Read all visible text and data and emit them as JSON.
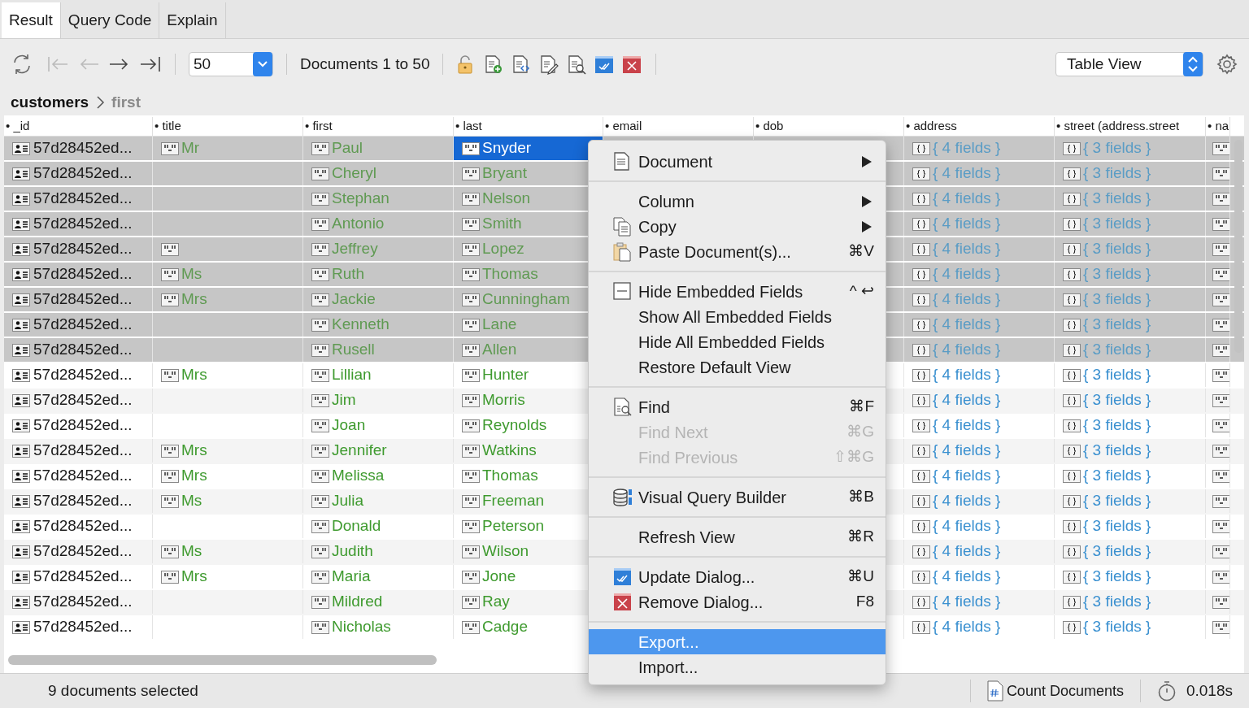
{
  "tabs": [
    {
      "label": "Result",
      "selected": true
    },
    {
      "label": "Query Code",
      "selected": false
    },
    {
      "label": "Explain",
      "selected": false
    }
  ],
  "toolbar": {
    "nav_buttons": [
      {
        "kind": "first",
        "disabled": true
      },
      {
        "kind": "previous",
        "disabled": true
      },
      {
        "kind": "next",
        "disabled": false
      },
      {
        "kind": "last",
        "disabled": false
      }
    ],
    "page_size": {
      "value": "50"
    },
    "range": "Documents 1 to 50",
    "actions": [
      {
        "kind": "lock"
      },
      {
        "kind": "add"
      },
      {
        "kind": "code"
      },
      {
        "kind": "edit"
      },
      {
        "kind": "find"
      },
      {
        "kind": "update"
      },
      {
        "kind": "remove"
      }
    ],
    "view": {
      "value": "Table View"
    }
  },
  "breadcrumb": [
    {
      "label": "customers",
      "current": false
    },
    {
      "label": "first",
      "current": true
    }
  ],
  "table": {
    "columns": [
      {
        "label": "• _id",
        "kind": "id"
      },
      {
        "label": "• title",
        "kind": "string"
      },
      {
        "label": "• first",
        "kind": "string"
      },
      {
        "label": "• last",
        "kind": "string"
      },
      {
        "label": "• email",
        "kind": "hidden"
      },
      {
        "label": "• dob",
        "kind": "hidden"
      },
      {
        "label": "• address",
        "kind": "object"
      },
      {
        "label": "• street (address.street",
        "kind": "object"
      },
      {
        "label": "• na",
        "kind": "icon"
      }
    ],
    "rows": [
      {
        "id": "57d28452ed...",
        "title": "Mr",
        "first": "Paul",
        "last": "Snyder",
        "address": "{ 4 fields }",
        "street": "{ 3 fields }",
        "selected": true,
        "focused": true
      },
      {
        "id": "57d28452ed...",
        "empty_title": false,
        "first": "Cheryl",
        "last": "Bryant",
        "address": "{ 4 fields }",
        "street": "{ 3 fields }",
        "selected": true,
        "focused": false
      },
      {
        "id": "57d28452ed...",
        "empty_title": false,
        "first": "Stephan",
        "last": "Nelson",
        "address": "{ 4 fields }",
        "street": "{ 3 fields }",
        "selected": true,
        "focused": false
      },
      {
        "id": "57d28452ed...",
        "empty_title": false,
        "first": "Antonio",
        "last": "Smith",
        "address": "{ 4 fields }",
        "street": "{ 3 fields }",
        "selected": true,
        "focused": false
      },
      {
        "id": "57d28452ed...",
        "empty_title": true,
        "first": "Jeffrey",
        "last": "Lopez",
        "address": "{ 4 fields }",
        "street": "{ 3 fields }",
        "selected": true,
        "focused": false
      },
      {
        "id": "57d28452ed...",
        "title": "Ms",
        "first": "Ruth",
        "last": "Thomas",
        "address": "{ 4 fields }",
        "street": "{ 3 fields }",
        "selected": true,
        "focused": false
      },
      {
        "id": "57d28452ed...",
        "title": "Mrs",
        "first": "Jackie",
        "last": "Cunningham",
        "address": "{ 4 fields }",
        "street": "{ 3 fields }",
        "selected": true,
        "focused": false
      },
      {
        "id": "57d28452ed...",
        "empty_title": false,
        "first": "Kenneth",
        "last": "Lane",
        "address": "{ 4 fields }",
        "street": "{ 3 fields }",
        "selected": true,
        "focused": false
      },
      {
        "id": "57d28452ed...",
        "empty_title": false,
        "first": "Rusell",
        "last": "Allen",
        "address": "{ 4 fields }",
        "street": "{ 3 fields }",
        "selected": true,
        "focused": false
      },
      {
        "id": "57d28452ed...",
        "title": "Mrs",
        "first": "Lillian",
        "last": "Hunter",
        "address": "{ 4 fields }",
        "street": "{ 3 fields }",
        "selected": false,
        "focused": false
      },
      {
        "id": "57d28452ed...",
        "empty_title": false,
        "first": "Jim",
        "last": "Morris",
        "address": "{ 4 fields }",
        "street": "{ 3 fields }",
        "selected": false,
        "focused": false
      },
      {
        "id": "57d28452ed...",
        "empty_title": false,
        "first": "Joan",
        "last": "Reynolds",
        "address": "{ 4 fields }",
        "street": "{ 3 fields }",
        "selected": false,
        "focused": false
      },
      {
        "id": "57d28452ed...",
        "title": "Mrs",
        "first": "Jennifer",
        "last": "Watkins",
        "address": "{ 4 fields }",
        "street": "{ 3 fields }",
        "selected": false,
        "focused": false
      },
      {
        "id": "57d28452ed...",
        "title": "Mrs",
        "first": "Melissa",
        "last": "Thomas",
        "address": "{ 4 fields }",
        "street": "{ 3 fields }",
        "selected": false,
        "focused": false
      },
      {
        "id": "57d28452ed...",
        "title": "Ms",
        "first": "Julia",
        "last": "Freeman",
        "address": "{ 4 fields }",
        "street": "{ 3 fields }",
        "selected": false,
        "focused": false
      },
      {
        "id": "57d28452ed...",
        "empty_title": false,
        "first": "Donald",
        "last": "Peterson",
        "address": "{ 4 fields }",
        "street": "{ 3 fields }",
        "selected": false,
        "focused": false
      },
      {
        "id": "57d28452ed...",
        "title": "Ms",
        "first": "Judith",
        "last": "Wilson",
        "address": "{ 4 fields }",
        "street": "{ 3 fields }",
        "selected": false,
        "focused": false
      },
      {
        "id": "57d28452ed...",
        "title": "Mrs",
        "first": "Maria",
        "last": "Jone",
        "address": "{ 4 fields }",
        "street": "{ 3 fields }",
        "selected": false,
        "focused": false
      },
      {
        "id": "57d28452ed...",
        "empty_title": false,
        "first": "Mildred",
        "last": "Ray",
        "address": "{ 4 fields }",
        "street": "{ 3 fields }",
        "selected": false,
        "focused": false
      },
      {
        "id": "57d28452ed...",
        "empty_title": false,
        "first": "Nicholas",
        "last": "Cadge",
        "address": "{ 4 fields }",
        "street": "{ 3 fields }",
        "selected": false,
        "focused": false
      }
    ]
  },
  "context_menu": {
    "items": [
      {
        "kind": "document",
        "label": "Document",
        "submenu": true,
        "disabled": false,
        "selected": false
      },
      {
        "kind": "separator"
      },
      {
        "kind": "plain",
        "label": "Column",
        "submenu": true,
        "disabled": false,
        "selected": false
      },
      {
        "kind": "copy",
        "label": "Copy",
        "submenu": true,
        "disabled": false,
        "selected": false
      },
      {
        "kind": "paste",
        "label": "Paste Document(s)...",
        "shortcut": "⌘V",
        "submenu": false,
        "disabled": false,
        "selected": false
      },
      {
        "kind": "separator"
      },
      {
        "kind": "collapse",
        "label": "Hide Embedded Fields",
        "shortcut": "^ ↩",
        "submenu": false,
        "disabled": false,
        "selected": false
      },
      {
        "kind": "plain",
        "label": "Show All Embedded Fields",
        "submenu": false,
        "disabled": false,
        "selected": false
      },
      {
        "kind": "plain",
        "label": "Hide All Embedded Fields",
        "submenu": false,
        "disabled": false,
        "selected": false
      },
      {
        "kind": "plain",
        "label": "Restore Default View",
        "submenu": false,
        "disabled": false,
        "selected": false
      },
      {
        "kind": "separator"
      },
      {
        "kind": "find",
        "label": "Find",
        "shortcut": "⌘F",
        "submenu": false,
        "disabled": false,
        "selected": false
      },
      {
        "kind": "plain",
        "label": "Find Next",
        "shortcut": "⌘G",
        "submenu": false,
        "disabled": true,
        "selected": false
      },
      {
        "kind": "plain",
        "label": "Find Previous",
        "shortcut": "⇧⌘G",
        "submenu": false,
        "disabled": true,
        "selected": false
      },
      {
        "kind": "separator"
      },
      {
        "kind": "database",
        "label": "Visual Query Builder",
        "shortcut": "⌘B",
        "submenu": false,
        "disabled": false,
        "selected": false
      },
      {
        "kind": "separator"
      },
      {
        "kind": "plain",
        "label": "Refresh View",
        "shortcut": "⌘R",
        "submenu": false,
        "disabled": false,
        "selected": false
      },
      {
        "kind": "separator"
      },
      {
        "kind": "update",
        "label": "Update Dialog...",
        "shortcut": "⌘U",
        "submenu": false,
        "disabled": false,
        "selected": false
      },
      {
        "kind": "remove",
        "label": "Remove Dialog...",
        "shortcut": "F8",
        "submenu": false,
        "disabled": false,
        "selected": false
      },
      {
        "kind": "separator"
      },
      {
        "kind": "plain",
        "label": "Export...",
        "submenu": false,
        "disabled": false,
        "selected": true
      },
      {
        "kind": "plain",
        "label": "Import...",
        "submenu": false,
        "disabled": false,
        "selected": false
      }
    ]
  },
  "status_bar": {
    "message": "9 documents selected",
    "count_button": "Count Documents",
    "elapsed": "0.018s"
  }
}
